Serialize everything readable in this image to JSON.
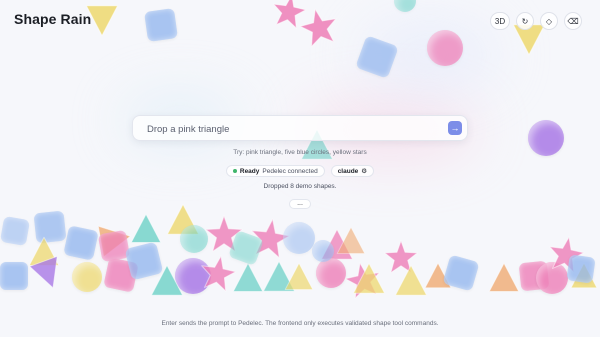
{
  "app": {
    "title": "Shape Rain"
  },
  "toolbar": {
    "mode_3d_label": "3D",
    "refresh_icon": "refresh-icon",
    "shape_icon": "diamond-icon",
    "clear_icon": "backspace-icon"
  },
  "prompt": {
    "value": "",
    "placeholder": "Drop a pink triangle",
    "send_icon": "arrow-right-icon"
  },
  "hint": "Try: pink triangle, five blue circles, yellow stars",
  "status": {
    "state": "Ready",
    "connection": "Pedelec connected",
    "model": "claude",
    "state_color": "#3fb56b"
  },
  "message": "Dropped 8 demo shapes.",
  "more_label": "...",
  "footer": "Enter sends the prompt to Pedelec. The frontend only executes validated shape tool commands.",
  "colors": {
    "pink": "#ee7fb8",
    "blue": "#8fb4ee",
    "purple": "#a979e6",
    "yellow": "#eed96f",
    "teal": "#64cfc4",
    "orange": "#f0ac74",
    "accent": "#7c8de8"
  }
}
